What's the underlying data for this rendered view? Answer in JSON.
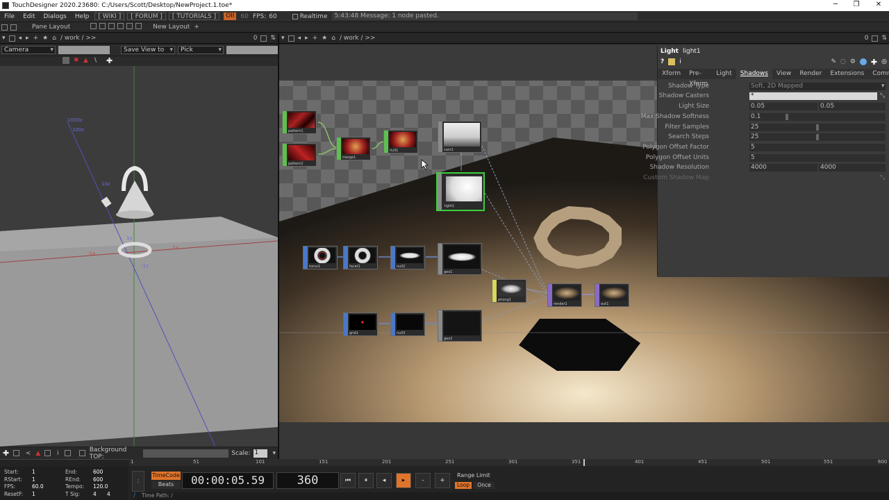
{
  "window": {
    "title": "TouchDesigner 2020.23680: C:/Users/Scott/Desktop/NewProject.1.toe*",
    "min": "─",
    "max": "❐",
    "close": "✕"
  },
  "menu": {
    "items": [
      "File",
      "Edit",
      "Dialogs",
      "Help"
    ],
    "links": [
      "[ WIKI ]",
      "[ FORUM ]",
      "[ TUTORIALS ]"
    ],
    "perf": "OII",
    "fps_value": "60",
    "fps_label": "FPS:",
    "fps": "60",
    "realtime": "Realtime",
    "message": "5:43:48 Message: 1 node pasted."
  },
  "pane": {
    "layout": "Pane Layout",
    "new_layout": "New Layout",
    "plus": "+"
  },
  "left_path": "/ work / >>",
  "right_path": "/ work / >>",
  "viewer": {
    "camera": "Camera",
    "save_view": "Save View to",
    "pick": "Pick",
    "bg_label": "Background TOP:",
    "scale_label": "Scale:",
    "scale": "1"
  },
  "axes": {
    "z1000": "1000z",
    "z100": "100z",
    "z10": "10z",
    "x1": "1x",
    "xneg": "-1x",
    "y1": "1y",
    "zneg": "-1z"
  },
  "params": {
    "type": "Light",
    "name": "light1",
    "tabs": [
      "Xform",
      "Pre-Xform",
      "Light",
      "Shadows",
      "View",
      "Render",
      "Extensions",
      "Common"
    ],
    "rows": [
      {
        "label": "Shadow Type",
        "value": "Soft, 2D Mapped",
        "value2": ""
      },
      {
        "label": "Shadow Casters",
        "value": "*",
        "value2": ""
      },
      {
        "label": "Light Size",
        "value": "0.05",
        "value2": "0.05"
      },
      {
        "label": "Max Shadow Softness",
        "value": "0.1",
        "value2": ""
      },
      {
        "label": "Filter Samples",
        "value": "25",
        "value2": ""
      },
      {
        "label": "Search Steps",
        "value": "25",
        "value2": ""
      },
      {
        "label": "Polygon Offset Factor",
        "value": "5",
        "value2": ""
      },
      {
        "label": "Polygon Offset Units",
        "value": "5",
        "value2": ""
      },
      {
        "label": "Shadow Resolution",
        "value": "4000",
        "value2": "4000"
      },
      {
        "label": "Custom Shadow Map",
        "value": "",
        "value2": ""
      }
    ]
  },
  "nodes": [
    {
      "id": "pattern1",
      "label": "pattern1",
      "color": "#5fbf4f"
    },
    {
      "id": "pattern2",
      "label": "pattern2",
      "color": "#5fbf4f"
    },
    {
      "id": "merge1",
      "label": "merge1",
      "color": "#5fbf4f"
    },
    {
      "id": "null1",
      "label": "null1",
      "color": "#5fbf4f"
    },
    {
      "id": "cam1",
      "label": "cam1",
      "color": "#8a8a8a"
    },
    {
      "id": "light1",
      "label": "light1",
      "color": "#8a8a8a"
    },
    {
      "id": "torus1",
      "label": "torus1",
      "color": "#4a78c8"
    },
    {
      "id": "facet1",
      "label": "facet1",
      "color": "#4a78c8"
    },
    {
      "id": "null2",
      "label": "null2",
      "color": "#4a78c8"
    },
    {
      "id": "geo1",
      "label": "geo1",
      "color": "#8a8a8a"
    },
    {
      "id": "phong1",
      "label": "phong1",
      "color": "#d8d65a"
    },
    {
      "id": "render1",
      "label": "render1",
      "color": "#8a6ac8"
    },
    {
      "id": "out1",
      "label": "out1",
      "color": "#8a6ac8"
    },
    {
      "id": "grid1",
      "label": "grid1",
      "color": "#4a78c8"
    },
    {
      "id": "null3",
      "label": "null3",
      "color": "#4a78c8"
    },
    {
      "id": "geo2",
      "label": "geo2",
      "color": "#8a8a8a"
    }
  ],
  "timeline": {
    "start_l": "Start:",
    "start": "1",
    "end_l": "End:",
    "end": "600",
    "rstart_l": "RStart:",
    "rstart": "1",
    "rend_l": "REnd:",
    "rend": "600",
    "fps_l": "FPS:",
    "fps": "60.0",
    "tempo_l": "Tempo:",
    "tempo": "120.0",
    "resetf_l": "ResetF:",
    "resetf": "1",
    "tsig_l": "T Sig:",
    "tsig_a": "4",
    "tsig_b": "4",
    "timecode": "TimeCode",
    "beats": "Beats",
    "time": "00:00:05.59",
    "frame": "360",
    "range": "Range Limit",
    "loop": "Loop",
    "once": "Once",
    "timepath": "Time Path: /",
    "ticks": [
      "1",
      "51",
      "101",
      "151",
      "201",
      "251",
      "301",
      "351",
      "401",
      "451",
      "501",
      "551",
      "600"
    ]
  }
}
